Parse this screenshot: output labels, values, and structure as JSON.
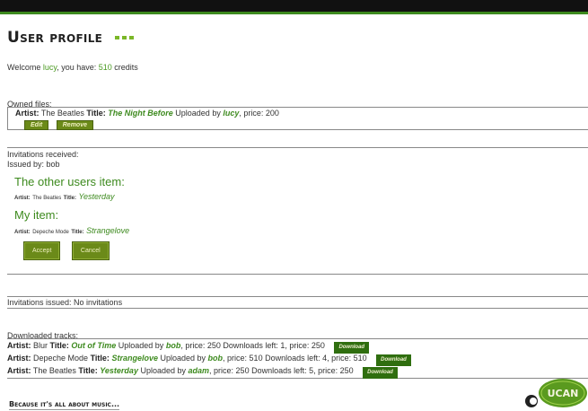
{
  "header": {
    "title": "User profile"
  },
  "welcome": {
    "prefix": "Welcome ",
    "user": "lucy",
    "middle": ", you have: ",
    "credits": "510",
    "suffix": " credits"
  },
  "owned": {
    "label": "Owned files:",
    "item": {
      "artist_label": "Artist:",
      "artist": "The Beatles",
      "title_label": "Title:",
      "title": "The Night Before",
      "uploaded_by": "Uploaded by",
      "uploader": "lucy",
      "price": ", price: 200"
    },
    "edit_label": "Edit",
    "remove_label": "Remove"
  },
  "invitations_received": {
    "label": "Invitations received:",
    "issued_by": "Issued by: bob",
    "other_heading": "The other users item:",
    "other_item": {
      "artist_label": "Artist:",
      "artist": "The Beatles",
      "title_label": "Title:",
      "title": "Yesterday"
    },
    "my_heading": "My item:",
    "my_item": {
      "artist_label": "Artist:",
      "artist": "Depeche Mode",
      "title_label": "Title:",
      "title": "Strangelove"
    },
    "accept_label": "Accept",
    "cancel_label": "Cancel"
  },
  "invitations_issued": {
    "text": "Invitations issued: No invitations"
  },
  "downloaded": {
    "label": "Downloaded tracks:",
    "download_label": "Download",
    "tracks": [
      {
        "artist_label": "Artist:",
        "artist": "Blur",
        "title_label": "Title:",
        "title": "Out of Time",
        "uploaded_by": "Uploaded by",
        "uploader": "bob",
        "details": ", price: 250 Downloads left: 1, price: 250"
      },
      {
        "artist_label": "Artist:",
        "artist": "Depeche Mode",
        "title_label": "Title:",
        "title": "Strangelove",
        "uploaded_by": "Uploaded by",
        "uploader": "bob",
        "details": ", price: 510 Downloads left: 4, price: 510"
      },
      {
        "artist_label": "Artist:",
        "artist": "The Beatles",
        "title_label": "Title:",
        "title": "Yesterday",
        "uploaded_by": "Uploaded by",
        "uploader": "adam",
        "details": ", price: 250 Downloads left: 5, price: 250"
      }
    ]
  },
  "footer": {
    "tagline": "Because it's all about music..."
  },
  "logo": {
    "text": "UCAN"
  }
}
